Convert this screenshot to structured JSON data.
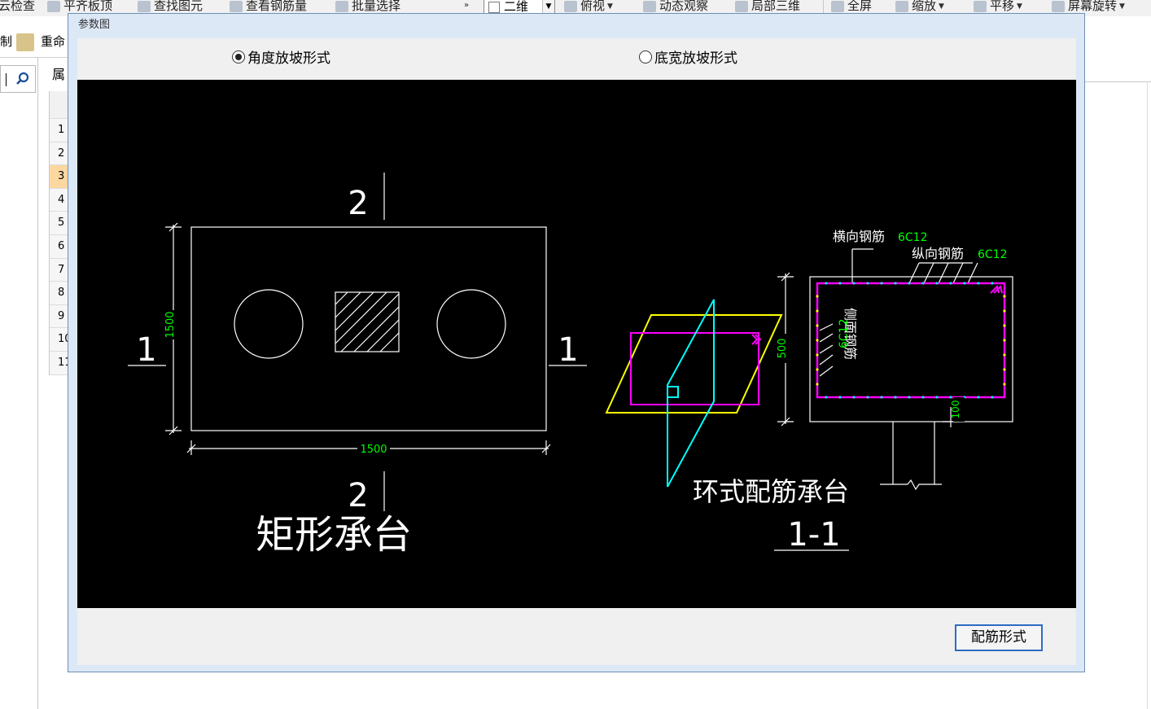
{
  "toolbar": {
    "items": [
      {
        "label": "云检查"
      },
      {
        "label": "平齐板顶"
      },
      {
        "label": "查找图元"
      },
      {
        "label": "查看钢筋量"
      },
      {
        "label": "批量选择"
      },
      {
        "label": "俯视"
      },
      {
        "label": "动态观察"
      },
      {
        "label": "局部三维"
      },
      {
        "label": "全屏"
      },
      {
        "label": "缩放"
      },
      {
        "label": "平移"
      },
      {
        "label": "屏幕旋转"
      }
    ],
    "view_mode": "二维"
  },
  "row2": {
    "item1": "制",
    "item2": "重命"
  },
  "left_panel": {
    "header_label": "属",
    "row_numbers": [
      "1",
      "2",
      "3",
      "4",
      "5",
      "6",
      "7",
      "8",
      "9",
      "10",
      "11"
    ],
    "selected_row": "3"
  },
  "dialog": {
    "title": "参数图",
    "radio_angle": "角度放坡形式",
    "radio_width": "底宽放坡形式",
    "selected": "角度放坡形式",
    "button_label": "配筋形式"
  },
  "drawing": {
    "rect_title": "矩形承台",
    "ring_title": "环式配筋承台",
    "section_label": "1-1",
    "cut_marker_1": "1",
    "cut_marker_2": "2",
    "dim_width": "1500",
    "dim_height": "1500",
    "dim_height_section": "500",
    "dim_100": "100",
    "label_transverse": "横向钢筋",
    "value_transverse": "6C12",
    "label_longitudinal": "纵向钢筋",
    "value_longitudinal": "6C12",
    "label_side": "侧面钢筋",
    "value_side": "6C12",
    "colors": {
      "background": "#000000",
      "line": "#ffffff",
      "dim_text": "#00ff00",
      "magenta": "#ff00ff",
      "yellow": "#ffff00",
      "cyan": "#00ffff"
    }
  }
}
